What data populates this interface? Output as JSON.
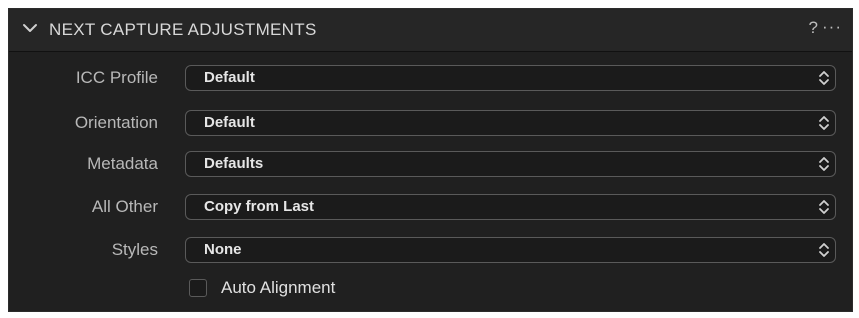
{
  "panel": {
    "title": "NEXT CAPTURE ADJUSTMENTS",
    "help_label": "?",
    "more_label": "···"
  },
  "rows": [
    {
      "label": "ICC Profile",
      "value": "Default"
    },
    {
      "label": "Orientation",
      "value": "Default"
    },
    {
      "label": "Metadata",
      "value": "Defaults"
    },
    {
      "label": "All Other",
      "value": "Copy from Last"
    },
    {
      "label": "Styles",
      "value": "None"
    }
  ],
  "auto_alignment": {
    "label": "Auto Alignment",
    "checked": false
  },
  "icons": {
    "collapse": "chevron-down-icon",
    "help": "help-icon",
    "more": "more-icon",
    "select_arrows": "up-down-arrows-icon"
  }
}
